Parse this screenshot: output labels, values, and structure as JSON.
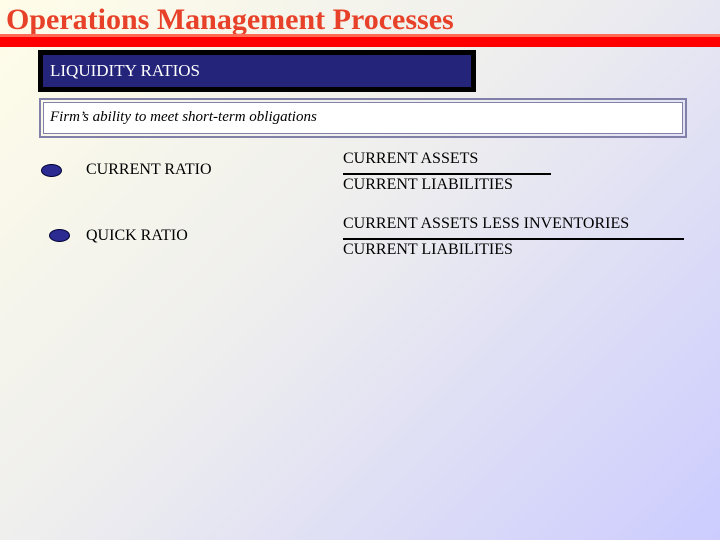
{
  "slide": {
    "title": "Operations Management Processes"
  },
  "section": {
    "heading": "LIQUIDITY RATIOS"
  },
  "definition": {
    "text": "Firm’s ability to meet short-term obligations"
  },
  "ratios": [
    {
      "name": "CURRENT RATIO",
      "numerator": "CURRENT ASSETS",
      "denominator": "CURRENT LIABILITIES"
    },
    {
      "name": "QUICK RATIO",
      "numerator": "CURRENT ASSETS LESS INVENTORIES",
      "denominator": "CURRENT LIABILITIES"
    }
  ],
  "colors": {
    "title": "#e8412a",
    "title_bar": "#ff0000",
    "section_fill": "#24247a",
    "bullet": "#2b2b92"
  }
}
